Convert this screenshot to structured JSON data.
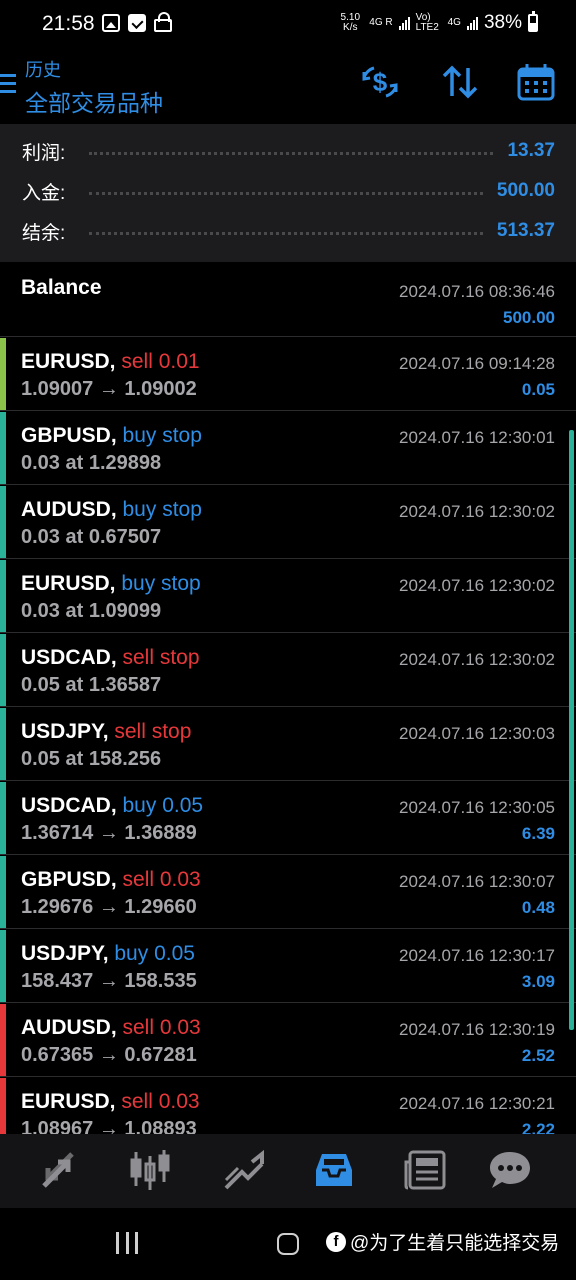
{
  "status_bar": {
    "time": "21:58",
    "net_speed_value": "5.10",
    "net_speed_unit": "K/s",
    "sim1": "4G R",
    "volte": "Vo) LTE2",
    "sim2": "4G",
    "battery": "38%"
  },
  "header": {
    "subtitle": "历史",
    "title": "全部交易品种"
  },
  "summary": {
    "profit_label": "利润:",
    "profit_value": "13.37",
    "deposit_label": "入金:",
    "deposit_value": "500.00",
    "balance_label": "结余:",
    "balance_value": "513.37"
  },
  "rows": [
    {
      "symbol": "Balance",
      "action": "",
      "detail": "",
      "time": "2024.07.16 08:36:46",
      "profit": "500.00"
    },
    {
      "symbol": "EURUSD,",
      "action": " sell 0.01",
      "action_type": "sell",
      "detail": "1.09007 → 1.09002",
      "time": "2024.07.16 09:14:28",
      "profit": "0.05"
    },
    {
      "symbol": "GBPUSD,",
      "action": " buy stop",
      "action_type": "buy",
      "detail": "0.03 at 1.29898",
      "time": "2024.07.16 12:30:01",
      "profit": ""
    },
    {
      "symbol": "AUDUSD,",
      "action": " buy stop",
      "action_type": "buy",
      "detail": "0.03 at 0.67507",
      "time": "2024.07.16 12:30:02",
      "profit": ""
    },
    {
      "symbol": "EURUSD,",
      "action": " buy stop",
      "action_type": "buy",
      "detail": "0.03 at 1.09099",
      "time": "2024.07.16 12:30:02",
      "profit": ""
    },
    {
      "symbol": "USDCAD,",
      "action": " sell stop",
      "action_type": "sell",
      "detail": "0.05 at 1.36587",
      "time": "2024.07.16 12:30:02",
      "profit": ""
    },
    {
      "symbol": "USDJPY,",
      "action": " sell stop",
      "action_type": "sell",
      "detail": "0.05 at 158.256",
      "time": "2024.07.16 12:30:03",
      "profit": ""
    },
    {
      "symbol": "USDCAD,",
      "action": " buy 0.05",
      "action_type": "buy",
      "detail": "1.36714 → 1.36889",
      "time": "2024.07.16 12:30:05",
      "profit": "6.39"
    },
    {
      "symbol": "GBPUSD,",
      "action": " sell 0.03",
      "action_type": "sell",
      "detail": "1.29676 → 1.29660",
      "time": "2024.07.16 12:30:07",
      "profit": "0.48"
    },
    {
      "symbol": "USDJPY,",
      "action": " buy 0.05",
      "action_type": "buy",
      "detail": "158.437 → 158.535",
      "time": "2024.07.16 12:30:17",
      "profit": "3.09"
    },
    {
      "symbol": "AUDUSD,",
      "action": " sell 0.03",
      "action_type": "sell",
      "detail": "0.67365 → 0.67281",
      "time": "2024.07.16 12:30:19",
      "profit": "2.52"
    },
    {
      "symbol": "EURUSD,",
      "action": " sell 0.03",
      "action_type": "sell",
      "detail": "1.08967 → 1.08893",
      "time": "2024.07.16 12:30:21",
      "profit": "2.22"
    }
  ],
  "bottom_nav": {
    "icons": [
      "trade-arrows-icon",
      "candlestick-icon",
      "chart-line-icon",
      "history-inbox-icon",
      "news-icon",
      "chat-icon"
    ],
    "active_index": 3
  },
  "watermark": {
    "logo": "f",
    "text": "@为了生着只能选择交易"
  },
  "colors": {
    "accent": "#2f8de4",
    "sell": "#e6383b",
    "buy": "#2f8de4",
    "profit_bar": "#8bc34a",
    "order_bar": "#2bb39a",
    "loss_bar": "#e6383b",
    "background": "#000000",
    "summary_bg": "#1c1c1e"
  }
}
